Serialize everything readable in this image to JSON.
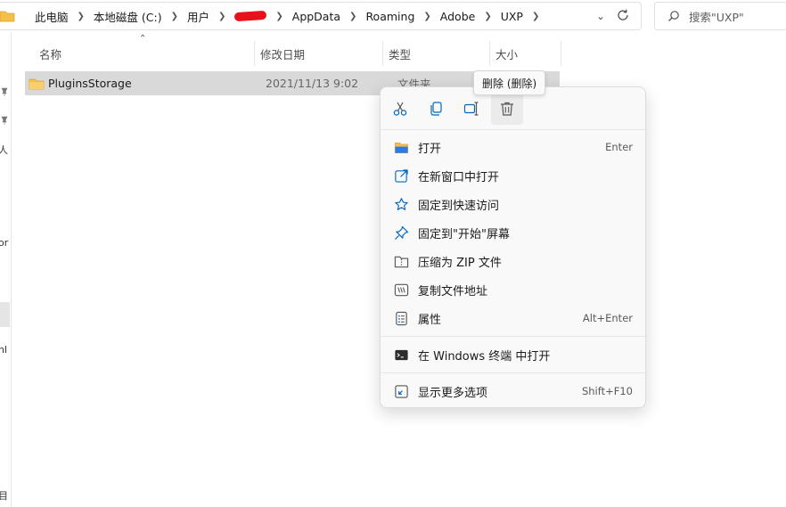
{
  "address_bar": {
    "crumbs": [
      "此电脑",
      "本地磁盘 (C:)",
      "用户",
      "AppData",
      "Roaming",
      "Adobe",
      "UXP"
    ]
  },
  "search": {
    "placeholder": "搜索\"UXP\""
  },
  "nav_fragments": [
    "人",
    "or",
    "nl",
    "目"
  ],
  "columns": {
    "name": "名称",
    "date": "修改日期",
    "type": "类型",
    "size": "大小"
  },
  "file_rows": [
    {
      "name": "PluginsStorage",
      "date": "2021/11/13 9:02",
      "type": "文件夹"
    }
  ],
  "tooltip": {
    "text": "删除 (删除)"
  },
  "context_menu": {
    "toolbar": [
      {
        "icon": "cut-icon"
      },
      {
        "icon": "copy-icon"
      },
      {
        "icon": "rename-icon"
      },
      {
        "icon": "delete-icon",
        "hovered": true
      }
    ],
    "items": [
      {
        "icon": "open-folder-icon",
        "label": "打开",
        "shortcut": "Enter"
      },
      {
        "icon": "new-window-icon",
        "label": "在新窗口中打开",
        "shortcut": ""
      },
      {
        "icon": "star-icon",
        "label": "固定到快速访问",
        "shortcut": ""
      },
      {
        "icon": "pin-icon",
        "label": "固定到\"开始\"屏幕",
        "shortcut": ""
      },
      {
        "icon": "zip-icon",
        "label": "压缩为 ZIP 文件",
        "shortcut": ""
      },
      {
        "icon": "copy-path-icon",
        "label": "复制文件地址",
        "shortcut": ""
      },
      {
        "icon": "properties-icon",
        "label": "属性",
        "shortcut": "Alt+Enter"
      },
      {
        "icon": "terminal-icon",
        "label": "在 Windows 终端 中打开",
        "shortcut": ""
      },
      {
        "icon": "more-options-icon",
        "label": "显示更多选项",
        "shortcut": "Shift+F10"
      }
    ]
  },
  "colors": {
    "accent": "#0067c0",
    "folder": "#f5c04a",
    "selection": "#d9d9d9",
    "redaction": "#e8101b"
  }
}
